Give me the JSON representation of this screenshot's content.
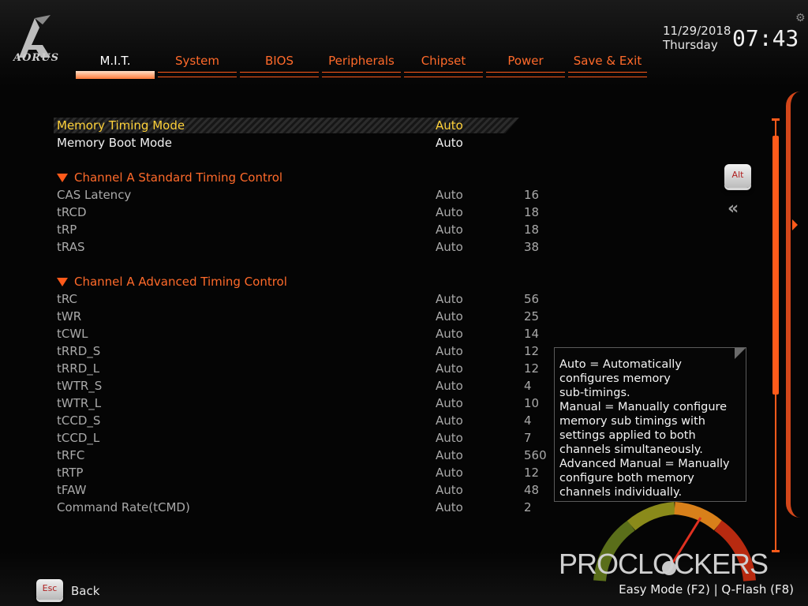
{
  "brand": {
    "logo_text": "AORUS"
  },
  "nav": {
    "tabs": [
      {
        "label": "M.I.T.",
        "active": true
      },
      {
        "label": "System"
      },
      {
        "label": "BIOS"
      },
      {
        "label": "Peripherals"
      },
      {
        "label": "Chipset"
      },
      {
        "label": "Power"
      },
      {
        "label": "Save & Exit"
      }
    ]
  },
  "clock": {
    "date": "11/29/2018",
    "day": "Thursday",
    "time": "07:43"
  },
  "settings": {
    "memory_timing_mode": {
      "label": "Memory Timing Mode",
      "value": "Auto"
    },
    "memory_boot_mode": {
      "label": "Memory Boot Mode",
      "value": "Auto"
    },
    "section_standard": "Channel A Standard Timing Control",
    "standard": [
      {
        "label": "CAS Latency",
        "mode": "Auto",
        "value": "16"
      },
      {
        "label": "tRCD",
        "mode": "Auto",
        "value": "18"
      },
      {
        "label": "tRP",
        "mode": "Auto",
        "value": "18"
      },
      {
        "label": "tRAS",
        "mode": "Auto",
        "value": "38"
      }
    ],
    "section_advanced": "Channel A Advanced Timing Control",
    "advanced": [
      {
        "label": "tRC",
        "mode": "Auto",
        "value": "56"
      },
      {
        "label": "tWR",
        "mode": "Auto",
        "value": "25"
      },
      {
        "label": "tCWL",
        "mode": "Auto",
        "value": "14"
      },
      {
        "label": "tRRD_S",
        "mode": "Auto",
        "value": "12"
      },
      {
        "label": "tRRD_L",
        "mode": "Auto",
        "value": "12"
      },
      {
        "label": "tWTR_S",
        "mode": "Auto",
        "value": "4"
      },
      {
        "label": "tWTR_L",
        "mode": "Auto",
        "value": "10"
      },
      {
        "label": "tCCD_S",
        "mode": "Auto",
        "value": "4"
      },
      {
        "label": "tCCD_L",
        "mode": "Auto",
        "value": "7"
      },
      {
        "label": "tRFC",
        "mode": "Auto",
        "value": "560"
      },
      {
        "label": "tRTP",
        "mode": "Auto",
        "value": "12"
      },
      {
        "label": "tFAW",
        "mode": "Auto",
        "value": "48"
      },
      {
        "label": "Command Rate(tCMD)",
        "mode": "Auto",
        "value": "2"
      }
    ]
  },
  "help": {
    "lines": [
      "Auto = Automatically",
      "configures memory",
      "sub-timings.",
      "Manual = Manually configure",
      "memory sub timings with",
      "settings applied to both",
      "channels simultaneously.",
      "Advanced Manual = Manually",
      "configure both memory",
      "channels individually."
    ]
  },
  "keys": {
    "alt": "Alt",
    "esc": "Esc",
    "chevron": "«"
  },
  "footer": {
    "back_label": "Back",
    "shortcuts": "Easy Mode (F2)  |  Q-Flash (F8)"
  },
  "watermark": "PROCLOCKERS",
  "icons": {
    "settings": "gear-icon",
    "collapse": "double-chevron-left-icon",
    "section": "triangle-down-icon"
  },
  "colors": {
    "accent": "#ff5a1a",
    "selected_text": "#ffd23a",
    "background": "#050505"
  }
}
